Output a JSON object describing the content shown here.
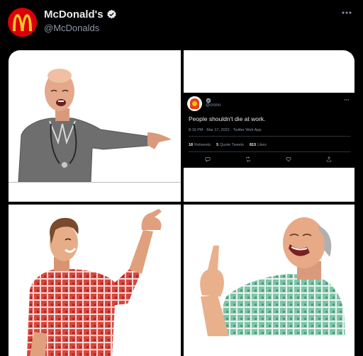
{
  "account": {
    "display_name": "McDonald's",
    "handle": "@McDonalds",
    "brand_color": "#db0007",
    "logo_color": "#ffc72c"
  },
  "embedded_tweet": {
    "handle": "@crono",
    "text": "People shouldn't die at work.",
    "meta": "8:16 PM · Mar 17, 2022 · Twitter Web App",
    "stats": [
      {
        "count": "18",
        "label": "Retweets"
      },
      {
        "count": "5",
        "label": "Quote Tweets"
      },
      {
        "count": "815",
        "label": "Likes"
      }
    ],
    "icons": [
      "reply-icon",
      "retweet-icon",
      "like-icon",
      "share-icon"
    ]
  }
}
